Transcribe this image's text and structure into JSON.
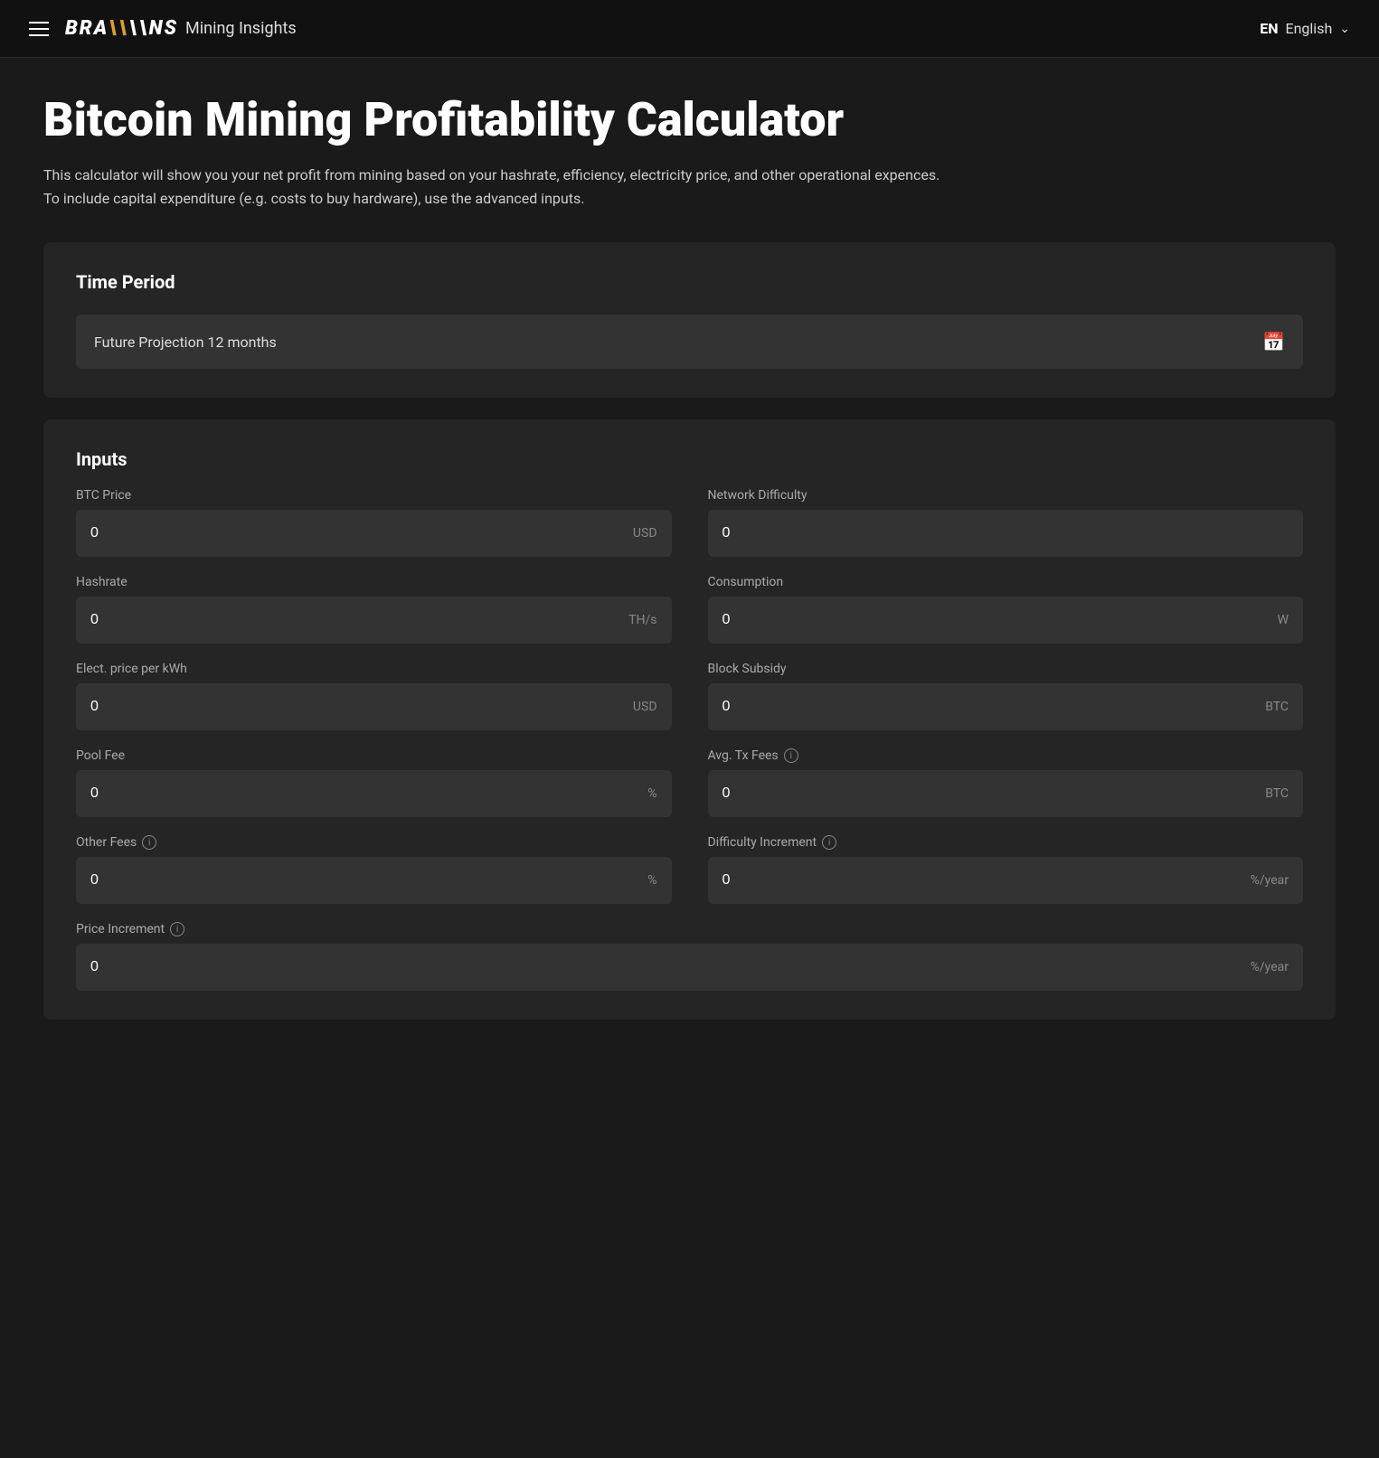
{
  "navbar": {
    "hamburger_label": "menu",
    "brand_logo": "BRA\\\\NS",
    "brand_subtitle": "Mining Insights",
    "lang_code": "EN",
    "lang_name": "English",
    "chevron": "∨"
  },
  "page": {
    "title": "Bitcoin Mining Profitability Calculator",
    "description": "This calculator will show you your net profit from mining based on your hashrate, efficiency, electricity price, and other operational expences. To include capital expenditure (e.g. costs to buy hardware), use the advanced inputs."
  },
  "time_period": {
    "section_title": "Time Period",
    "selected": "Future Projection 12 months"
  },
  "inputs": {
    "section_title": "Inputs",
    "fields": [
      {
        "label": "BTC Price",
        "value": "0",
        "unit": "USD",
        "has_info": false,
        "id": "btc-price"
      },
      {
        "label": "Network Difficulty",
        "value": "0",
        "unit": "",
        "has_info": false,
        "id": "network-difficulty"
      },
      {
        "label": "Hashrate",
        "value": "0",
        "unit": "TH/s",
        "has_info": false,
        "id": "hashrate"
      },
      {
        "label": "Consumption",
        "value": "0",
        "unit": "W",
        "has_info": false,
        "id": "consumption"
      },
      {
        "label": "Elect. price per kWh",
        "value": "0",
        "unit": "USD",
        "has_info": false,
        "id": "electricity-price"
      },
      {
        "label": "Block Subsidy",
        "value": "0",
        "unit": "BTC",
        "has_info": false,
        "id": "block-subsidy"
      },
      {
        "label": "Pool Fee",
        "value": "0",
        "unit": "%",
        "has_info": false,
        "id": "pool-fee"
      },
      {
        "label": "Avg. Tx Fees",
        "value": "0",
        "unit": "BTC",
        "has_info": true,
        "id": "avg-tx-fees"
      },
      {
        "label": "Other Fees",
        "value": "0",
        "unit": "%",
        "has_info": true,
        "id": "other-fees"
      },
      {
        "label": "Difficulty Increment",
        "value": "0",
        "unit": "%/year",
        "has_info": true,
        "id": "difficulty-increment"
      }
    ],
    "full_width_field": {
      "label": "Price Increment",
      "value": "0",
      "unit": "%/year",
      "has_info": true,
      "id": "price-increment"
    }
  }
}
